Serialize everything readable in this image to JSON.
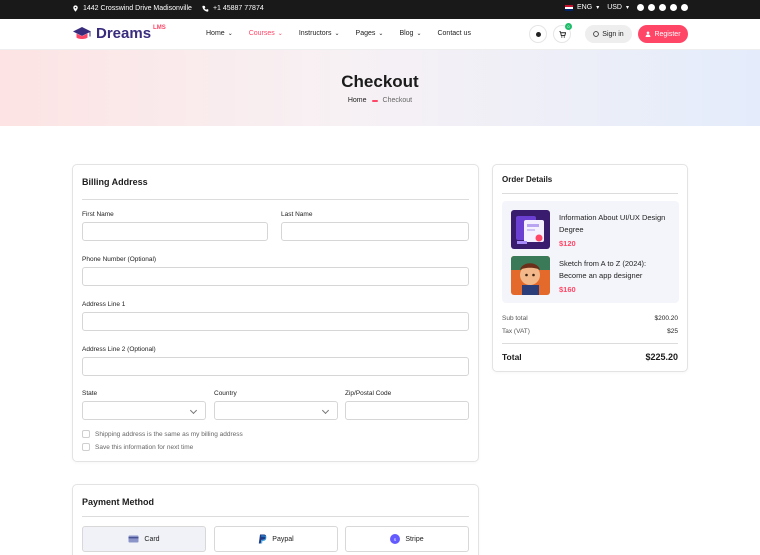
{
  "topbar": {
    "address": "1442 Crosswind Drive Madisonville",
    "phone": "+1 45887 77874",
    "language": "ENG",
    "currency": "USD",
    "socials": [
      "facebook-icon",
      "instagram-icon",
      "x-icon",
      "whatsapp-icon",
      "youtube-icon"
    ]
  },
  "header": {
    "logo_text": "Dreams",
    "logo_suffix": "LMS",
    "nav": [
      {
        "label": "Home",
        "active": false
      },
      {
        "label": "Courses",
        "active": true
      },
      {
        "label": "Instructors",
        "active": false
      },
      {
        "label": "Pages",
        "active": false
      },
      {
        "label": "Blog",
        "active": false
      },
      {
        "label": "Contact us",
        "active": false
      }
    ],
    "cart_count": "0",
    "signin_label": "Sign in",
    "register_label": "Register"
  },
  "banner": {
    "title": "Checkout",
    "breadcrumb_home": "Home",
    "breadcrumb_current": "Checkout"
  },
  "billing": {
    "title": "Billing Address",
    "first_name": {
      "label": "First Name",
      "value": ""
    },
    "last_name": {
      "label": "Last Name",
      "value": ""
    },
    "phone": {
      "label": "Phone Number (Optional)",
      "value": ""
    },
    "address1": {
      "label": "Address Line 1",
      "value": ""
    },
    "address2": {
      "label": "Address Line 2 (Optional)",
      "value": ""
    },
    "state": {
      "label": "State",
      "value": ""
    },
    "country": {
      "label": "Country",
      "value": ""
    },
    "zip": {
      "label": "Zip/Postal Code",
      "value": ""
    },
    "same_address_label": "Shipping address is the same as my billing address",
    "save_info_label": "Save this information for next time"
  },
  "payment": {
    "title": "Payment Method",
    "methods": [
      {
        "label": "Card",
        "selected": true
      },
      {
        "label": "Paypal",
        "selected": false
      },
      {
        "label": "Stripe",
        "selected": false
      }
    ]
  },
  "order": {
    "title": "Order Details",
    "items": [
      {
        "title": "Information About UI/UX Design Degree",
        "price": "$120"
      },
      {
        "title": "Sketch from A to Z (2024): Become an app designer",
        "price": "$160"
      }
    ],
    "subtotal_label": "Sub total",
    "subtotal_value": "$200.20",
    "tax_label": "Tax (VAT)",
    "tax_value": "$25",
    "total_label": "Total",
    "total_value": "$225.20"
  },
  "colors": {
    "accent": "#ff4667",
    "brand": "#392c7d",
    "topbar_bg": "#191919"
  }
}
